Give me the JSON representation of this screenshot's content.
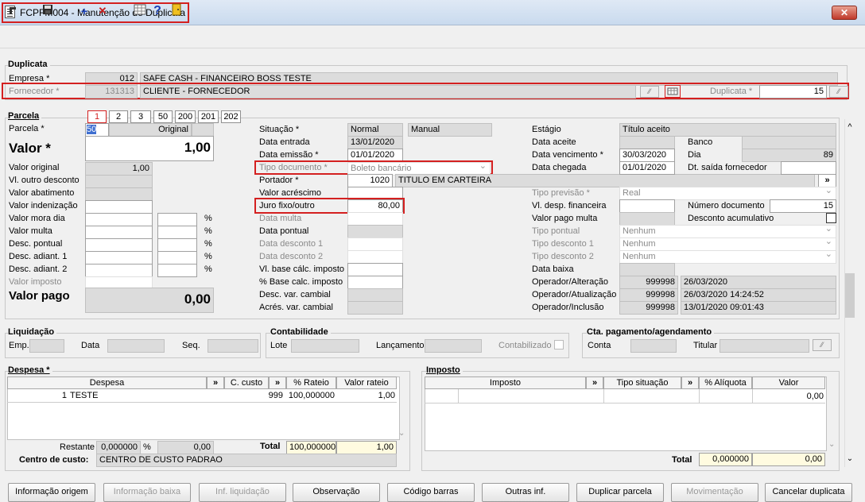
{
  "window": {
    "title": "FCPFM004 - Manutenção de Duplicata",
    "close": "✕"
  },
  "toolbar": {
    "icons": [
      "exit-icon",
      "save-icon",
      "add-icon",
      "delete-icon",
      "calculator-icon",
      "help-icon",
      "door-icon"
    ],
    "add": "+",
    "delete": "✕",
    "help": "?"
  },
  "duplicata": {
    "section": "Duplicata",
    "empresa_label": "Empresa *",
    "empresa_code": "012",
    "empresa_name": "SAFE CASH - FINANCEIRO BOSS TESTE",
    "fornecedor_label": "Fornecedor *",
    "fornecedor_code": "131313",
    "fornecedor_name": "CLIENTE - FORNECEDOR",
    "duplicata_label": "Duplicata *",
    "duplicata_value": "15"
  },
  "parcela": {
    "section": "Parcela",
    "tabs": [
      "1",
      "2",
      "3",
      "50",
      "200",
      "201",
      "202"
    ],
    "parcela_label": "Parcela *",
    "parcela_value": "50",
    "original_label": "Original",
    "valor_label": "Valor *",
    "valor_value": "1,00",
    "valor_original_label": "Valor original",
    "valor_original_value": "1,00",
    "vl_outro_desconto": "Vl. outro desconto",
    "valor_abatimento": "Valor abatimento",
    "valor_indenizacao": "Valor indenização",
    "valor_mora_dia": "Valor mora dia",
    "valor_multa": "Valor multa",
    "desc_pontual": "Desc. pontual",
    "desc_adiant1": "Desc. adiant. 1",
    "desc_adiant2": "Desc. adiant. 2",
    "valor_imposto": "Valor imposto",
    "valor_pago_label": "Valor pago",
    "valor_pago_value": "0,00",
    "pct": "%"
  },
  "mid": {
    "situacao_label": "Situação *",
    "situacao_value": "Normal",
    "situacao_mode": "Manual",
    "data_entrada_label": "Data entrada",
    "data_entrada": "13/01/2020",
    "data_emissao_label": "Data emissão *",
    "data_emissao": "01/01/2020",
    "tipo_doc_label": "Tipo documento *",
    "tipo_doc": "Boleto bancário",
    "portador_label": "Portador *",
    "portador_code": "1020",
    "portador_name": "TITULO EM CARTEIRA",
    "valor_acrescimo": "Valor acréscimo",
    "juro_label": "Juro fixo/outro",
    "juro_value": "80,00",
    "data_multa": "Data multa",
    "data_pontual": "Data pontual",
    "data_desc1": "Data desconto 1",
    "data_desc2": "Data desconto 2",
    "vl_base_calc": "Vl. base cálc. imposto",
    "pct_base_calc": "% Base calc. imposto",
    "desc_var_cambial": "Desc. var. cambial",
    "acres_var_cambial": "Acrés. var. cambial"
  },
  "right": {
    "estagio_label": "Estágio",
    "estagio_value": "Título aceito",
    "data_aceite": "Data aceite",
    "banco": "Banco",
    "data_vencimento_label": "Data vencimento *",
    "data_vencimento": "30/03/2020",
    "dia_label": "Dia",
    "dia_value": "89",
    "data_chegada_label": "Data chegada",
    "data_chegada": "01/01/2020",
    "dt_saida_label": "Dt. saída fornecedor",
    "tipo_previsao_label": "Tipo previsão *",
    "tipo_previsao": "Real",
    "vl_desp_fin": "Vl. desp. financeira",
    "numero_doc_label": "Número documento",
    "numero_doc": "15",
    "valor_pago_multa": "Valor pago multa",
    "desconto_acum": "Desconto acumulativo",
    "tipo_pontual": "Tipo pontual",
    "tipo_pontual_value": "Nenhum",
    "tipo_desc1": "Tipo desconto 1",
    "tipo_desc1_value": "Nenhum",
    "tipo_desc2": "Tipo desconto 2",
    "tipo_desc2_value": "Nenhum",
    "data_baixa": "Data baixa",
    "op_alteracao": "Operador/Alteração",
    "op_alteracao_code": "999998",
    "op_alteracao_dt": "26/03/2020",
    "op_atualizacao": "Operador/Atualização",
    "op_atualizacao_code": "999998",
    "op_atualizacao_dt": "26/03/2020 14:24:52",
    "op_inclusao": "Operador/Inclusão",
    "op_inclusao_code": "999998",
    "op_inclusao_dt": "13/01/2020 09:01:43",
    "arrow": "»"
  },
  "liquidacao": {
    "section": "Liquidação",
    "emp": "Emp.",
    "data": "Data",
    "seq": "Seq."
  },
  "contabilidade": {
    "section": "Contabilidade",
    "lote": "Lote",
    "lancamento": "Lançamento",
    "contabilizado": "Contabilizado"
  },
  "cta": {
    "section": "Cta. pagamento/agendamento",
    "conta": "Conta",
    "titular": "Titular"
  },
  "despesa": {
    "section": "Despesa *",
    "columns": [
      "Despesa",
      "»",
      "C. custo",
      "»",
      "% Rateio",
      "Valor rateio"
    ],
    "row": {
      "code": "1",
      "name": "TESTE",
      "ccusto": "999",
      "rateio": "100,000000",
      "valor": "1,00"
    },
    "restante_label": "Restante",
    "restante_pct": "0,000000",
    "pct": "%",
    "restante_valor": "0,00",
    "total_label": "Total",
    "total_pct": "100,000000",
    "total_valor": "1,00",
    "centro_label": "Centro de custo:",
    "centro_value": "CENTRO DE CUSTO PADRAO"
  },
  "imposto": {
    "section": "Imposto",
    "columns": [
      "Imposto",
      "»",
      "Tipo situação",
      "»",
      "% Alíquota",
      "Valor"
    ],
    "row_valor": "0,00",
    "total_label": "Total",
    "total_pct": "0,000000",
    "total_valor": "0,00"
  },
  "buttons": [
    "Informação origem",
    "Informação baixa",
    "Inf. liquidação",
    "Observação",
    "Código barras",
    "Outras inf.",
    "Duplicar parcela",
    "Movimentação",
    "Cancelar duplicata"
  ]
}
